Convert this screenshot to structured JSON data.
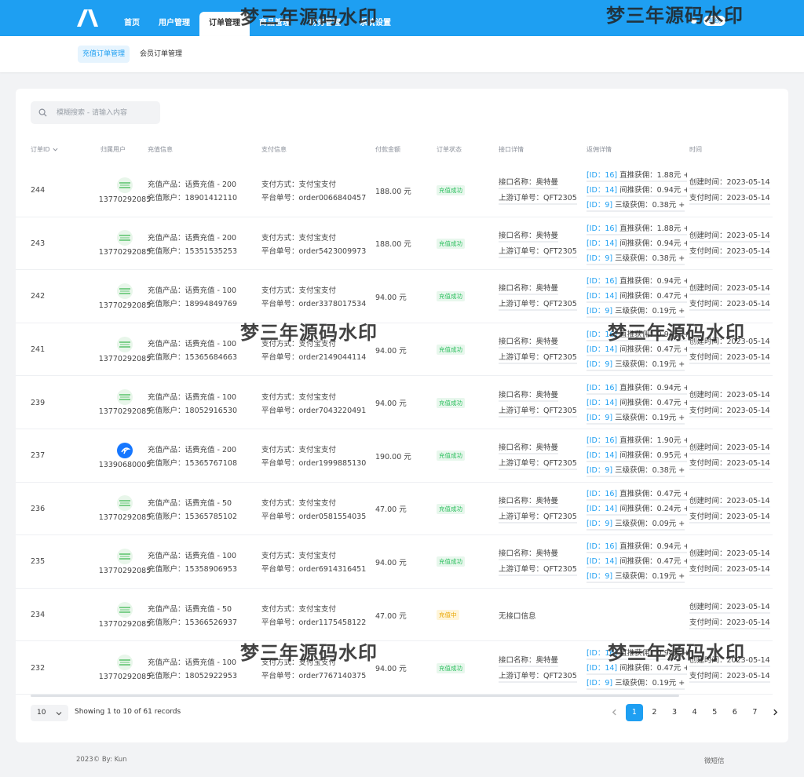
{
  "nav": {
    "items": [
      {
        "label": "首页"
      },
      {
        "label": "用户管理"
      },
      {
        "label": "订单管理"
      },
      {
        "label": "商品管理"
      },
      {
        "label": "财务管理"
      },
      {
        "label": "系统设置"
      }
    ],
    "active_index": 2
  },
  "topbar": {
    "badge": "系统"
  },
  "subnav": {
    "tabs": [
      {
        "label": "充值订单管理"
      },
      {
        "label": "会员订单管理"
      }
    ],
    "active_index": 0
  },
  "search": {
    "placeholder": "模糊搜索 - 请输入内容"
  },
  "table": {
    "headers": {
      "id": "订单ID",
      "user": "归属用户",
      "recharge": "充值信息",
      "pay": "支付信息",
      "amount": "付款金额",
      "status": "订单状态",
      "iface": "接口详情",
      "comm": "返佣详情",
      "time": "时间"
    },
    "rows": [
      {
        "id": "244",
        "user": "13770292085",
        "avatar": "green",
        "product": "充值产品：话费充值 - 200",
        "account": "充值账户：18901412110",
        "paymethod": "支付方式：支付宝支付",
        "order": "平台单号：order0066840457",
        "amount": "188.00 元",
        "status": "充值成功",
        "status_type": "ok",
        "iface_name": "接口名称：奥特曼",
        "iface_order": "上游订单号：QFT2305",
        "comm": [
          {
            "id": "[ID：16]",
            "text": " 直推获佣：1.88元 +"
          },
          {
            "id": "[ID：14]",
            "text": " 间推获佣：0.94元 +"
          },
          {
            "id": "[ID：9]",
            "text": " 三级获佣：0.38元 +"
          }
        ],
        "created": "创建时间：2023-05-14",
        "paid": "支付时间：2023-05-14"
      },
      {
        "id": "243",
        "user": "13770292085",
        "avatar": "green",
        "product": "充值产品：话费充值 - 200",
        "account": "充值账户：15351535253",
        "paymethod": "支付方式：支付宝支付",
        "order": "平台单号：order5423009973",
        "amount": "188.00 元",
        "status": "充值成功",
        "status_type": "ok",
        "iface_name": "接口名称：奥特曼",
        "iface_order": "上游订单号：QFT2305",
        "comm": [
          {
            "id": "[ID：16]",
            "text": " 直推获佣：1.88元 +"
          },
          {
            "id": "[ID：14]",
            "text": " 间推获佣：0.94元 +"
          },
          {
            "id": "[ID：9]",
            "text": " 三级获佣：0.38元 +"
          }
        ],
        "created": "创建时间：2023-05-14",
        "paid": "支付时间：2023-05-14"
      },
      {
        "id": "242",
        "user": "13770292085",
        "avatar": "green",
        "product": "充值产品：话费充值 - 100",
        "account": "充值账户：18994849769",
        "paymethod": "支付方式：支付宝支付",
        "order": "平台单号：order3378017534",
        "amount": "94.00 元",
        "status": "充值成功",
        "status_type": "ok",
        "iface_name": "接口名称：奥特曼",
        "iface_order": "上游订单号：QFT2305",
        "comm": [
          {
            "id": "[ID：16]",
            "text": " 直推获佣：0.94元 +"
          },
          {
            "id": "[ID：14]",
            "text": " 间推获佣：0.47元 +"
          },
          {
            "id": "[ID：9]",
            "text": " 三级获佣：0.19元 +"
          }
        ],
        "created": "创建时间：2023-05-14",
        "paid": "支付时间：2023-05-14"
      },
      {
        "id": "241",
        "user": "13770292085",
        "avatar": "green",
        "product": "充值产品：话费充值 - 100",
        "account": "充值账户：15365684663",
        "paymethod": "支付方式：支付宝支付",
        "order": "平台单号：order2149044114",
        "amount": "94.00 元",
        "status": "充值成功",
        "status_type": "ok",
        "iface_name": "接口名称：奥特曼",
        "iface_order": "上游订单号：QFT2305",
        "comm": [
          {
            "id": "[ID：16]",
            "text": " 直推获佣：0.94元 +"
          },
          {
            "id": "[ID：14]",
            "text": " 间推获佣：0.47元 +"
          },
          {
            "id": "[ID：9]",
            "text": " 三级获佣：0.19元 +"
          }
        ],
        "created": "创建时间：2023-05-14",
        "paid": "支付时间：2023-05-14"
      },
      {
        "id": "239",
        "user": "13770292085",
        "avatar": "green",
        "product": "充值产品：话费充值 - 100",
        "account": "充值账户：18052916530",
        "paymethod": "支付方式：支付宝支付",
        "order": "平台单号：order7043220491",
        "amount": "94.00 元",
        "status": "充值成功",
        "status_type": "ok",
        "iface_name": "接口名称：奥特曼",
        "iface_order": "上游订单号：QFT2305",
        "comm": [
          {
            "id": "[ID：16]",
            "text": " 直推获佣：0.94元 +"
          },
          {
            "id": "[ID：14]",
            "text": " 间推获佣：0.47元 +"
          },
          {
            "id": "[ID：9]",
            "text": " 三级获佣：0.19元 +"
          }
        ],
        "created": "创建时间：2023-05-14",
        "paid": "支付时间：2023-05-14"
      },
      {
        "id": "237",
        "user": "13390680005",
        "avatar": "blue",
        "product": "充值产品：话费充值 - 200",
        "account": "充值账户：15365767108",
        "paymethod": "支付方式：支付宝支付",
        "order": "平台单号：order1999885130",
        "amount": "190.00 元",
        "status": "充值成功",
        "status_type": "ok",
        "iface_name": "接口名称：奥特曼",
        "iface_order": "上游订单号：QFT2305",
        "comm": [
          {
            "id": "[ID：16]",
            "text": " 直推获佣：1.90元 +"
          },
          {
            "id": "[ID：14]",
            "text": " 间推获佣：0.95元 +"
          },
          {
            "id": "[ID：9]",
            "text": " 三级获佣：0.38元 +"
          }
        ],
        "created": "创建时间：2023-05-14",
        "paid": "支付时间：2023-05-14"
      },
      {
        "id": "236",
        "user": "13770292085",
        "avatar": "green",
        "product": "充值产品：话费充值 - 50",
        "account": "充值账户：15365785102",
        "paymethod": "支付方式：支付宝支付",
        "order": "平台单号：order0581554035",
        "amount": "47.00 元",
        "status": "充值成功",
        "status_type": "ok",
        "iface_name": "接口名称：奥特曼",
        "iface_order": "上游订单号：QFT2305",
        "comm": [
          {
            "id": "[ID：16]",
            "text": " 直推获佣：0.47元 +"
          },
          {
            "id": "[ID：14]",
            "text": " 间推获佣：0.24元 +"
          },
          {
            "id": "[ID：9]",
            "text": " 三级获佣：0.09元 +"
          }
        ],
        "created": "创建时间：2023-05-14",
        "paid": "支付时间：2023-05-14"
      },
      {
        "id": "235",
        "user": "13770292085",
        "avatar": "green",
        "product": "充值产品：话费充值 - 100",
        "account": "充值账户：15358906953",
        "paymethod": "支付方式：支付宝支付",
        "order": "平台单号：order6914316451",
        "amount": "94.00 元",
        "status": "充值成功",
        "status_type": "ok",
        "iface_name": "接口名称：奥特曼",
        "iface_order": "上游订单号：QFT2305",
        "comm": [
          {
            "id": "[ID：16]",
            "text": " 直推获佣：0.94元 +"
          },
          {
            "id": "[ID：14]",
            "text": " 间推获佣：0.47元 +"
          },
          {
            "id": "[ID：9]",
            "text": " 三级获佣：0.19元 +"
          }
        ],
        "created": "创建时间：2023-05-14",
        "paid": "支付时间：2023-05-14"
      },
      {
        "id": "234",
        "user": "13770292085",
        "avatar": "green",
        "product": "充值产品：话费充值 - 50",
        "account": "充值账户：15366526937",
        "paymethod": "支付方式：支付宝支付",
        "order": "平台单号：order1175458122",
        "amount": "47.00 元",
        "status": "充值中",
        "status_type": "pending",
        "iface_name": "无接口信息",
        "iface_order": "",
        "comm": [],
        "created": "创建时间：2023-05-14",
        "paid": "支付时间：2023-05-14"
      },
      {
        "id": "232",
        "user": "13770292085",
        "avatar": "green",
        "product": "充值产品：话费充值 - 100",
        "account": "充值账户：18052922953",
        "paymethod": "支付方式：支付宝支付",
        "order": "平台单号：order7767140375",
        "amount": "94.00 元",
        "status": "充值成功",
        "status_type": "ok",
        "iface_name": "接口名称：奥特曼",
        "iface_order": "上游订单号：QFT2305",
        "comm": [
          {
            "id": "[ID：16]",
            "text": " 直推获佣：0.94元 +"
          },
          {
            "id": "[ID：14]",
            "text": " 间推获佣：0.47元 +"
          },
          {
            "id": "[ID：9]",
            "text": " 三级获佣：0.19元 +"
          }
        ],
        "created": "创建时间：2023-05-14",
        "paid": "支付时间：2023-05-14"
      }
    ]
  },
  "pagination": {
    "page_size": "10",
    "records_text": "Showing 1 to 10 of 61 records",
    "pages": [
      "1",
      "2",
      "3",
      "4",
      "5",
      "6",
      "7"
    ],
    "current": "1"
  },
  "footer": {
    "left": "2023© By: Kun",
    "right": "微短信"
  },
  "watermark": "梦三年源码水印"
}
